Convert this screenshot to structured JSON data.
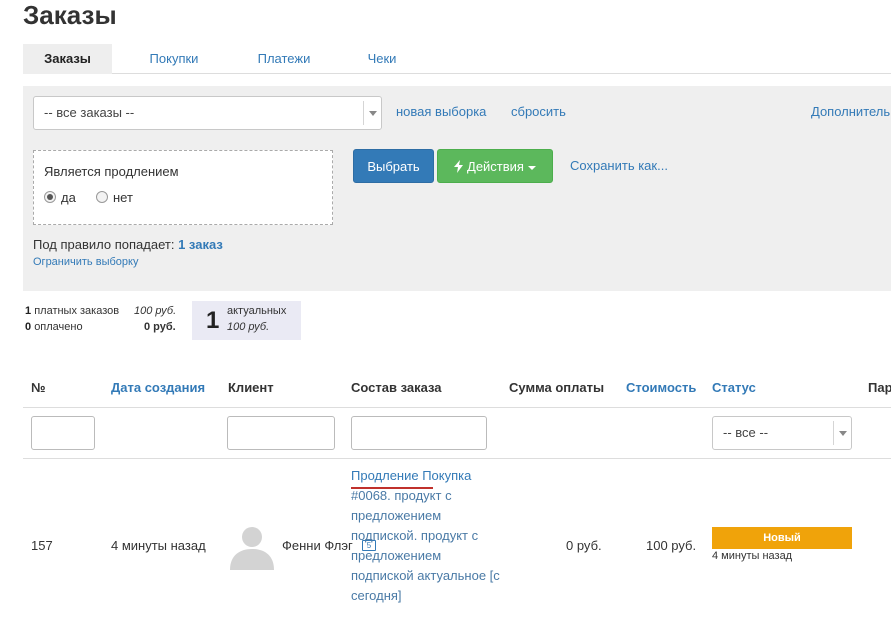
{
  "page_title": "Заказы",
  "tabs": [
    {
      "label": "Заказы",
      "active": true
    },
    {
      "label": "Покупки",
      "active": false
    },
    {
      "label": "Платежи",
      "active": false
    },
    {
      "label": "Чеки",
      "active": false
    }
  ],
  "filters": {
    "selection_select": {
      "value": "-- все заказы --"
    },
    "new_selection": "новая выборка",
    "reset": "сбросить",
    "additional": "Дополнительн",
    "condition": {
      "title": "Является продлением",
      "options": [
        {
          "label": "да",
          "checked": true
        },
        {
          "label": "нет",
          "checked": false
        }
      ]
    },
    "select_button": "Выбрать",
    "actions_button": "Действия",
    "save_as": "Сохранить как...",
    "rule_match_label": "Под правило попадает:",
    "rule_match_value": "1 заказ",
    "limit_selection": "Ограничить выборку"
  },
  "stats": {
    "paid_orders_count": "1",
    "paid_orders_label": "платных заказов",
    "paid_orders_sum": "100 руб.",
    "paid_count": "0",
    "paid_label": "оплачено",
    "paid_sum": "0 руб.",
    "actual_count": "1",
    "actual_label": "актуальных",
    "actual_sum": "100 руб."
  },
  "table": {
    "columns": [
      "№",
      "Дата создания",
      "Клиент",
      "Состав заказа",
      "Сумма оплаты",
      "Стоимость",
      "Статус",
      "Пар"
    ],
    "status_filter": "-- все --",
    "rows": [
      {
        "id": "157",
        "created": "4 минуты назад",
        "client": "Фенни Флэг",
        "composition_first": "Продление Покупка",
        "composition_rest": "#0068. продукт с предложением подпиской. продукт с предложением подпиской актуальное [с сегодня]",
        "paid_sum": "0 руб.",
        "cost": "100 руб.",
        "status": "Новый",
        "status_time": "4 минуты назад"
      }
    ]
  },
  "colors": {
    "primary": "#337ab7",
    "success": "#5cb85c",
    "status_new": "#f0a30a",
    "panel_bg": "#efefef"
  },
  "icons": [
    "user-avatar-icon",
    "lightning-icon",
    "chevron-down-icon",
    "client-card-icon"
  ]
}
